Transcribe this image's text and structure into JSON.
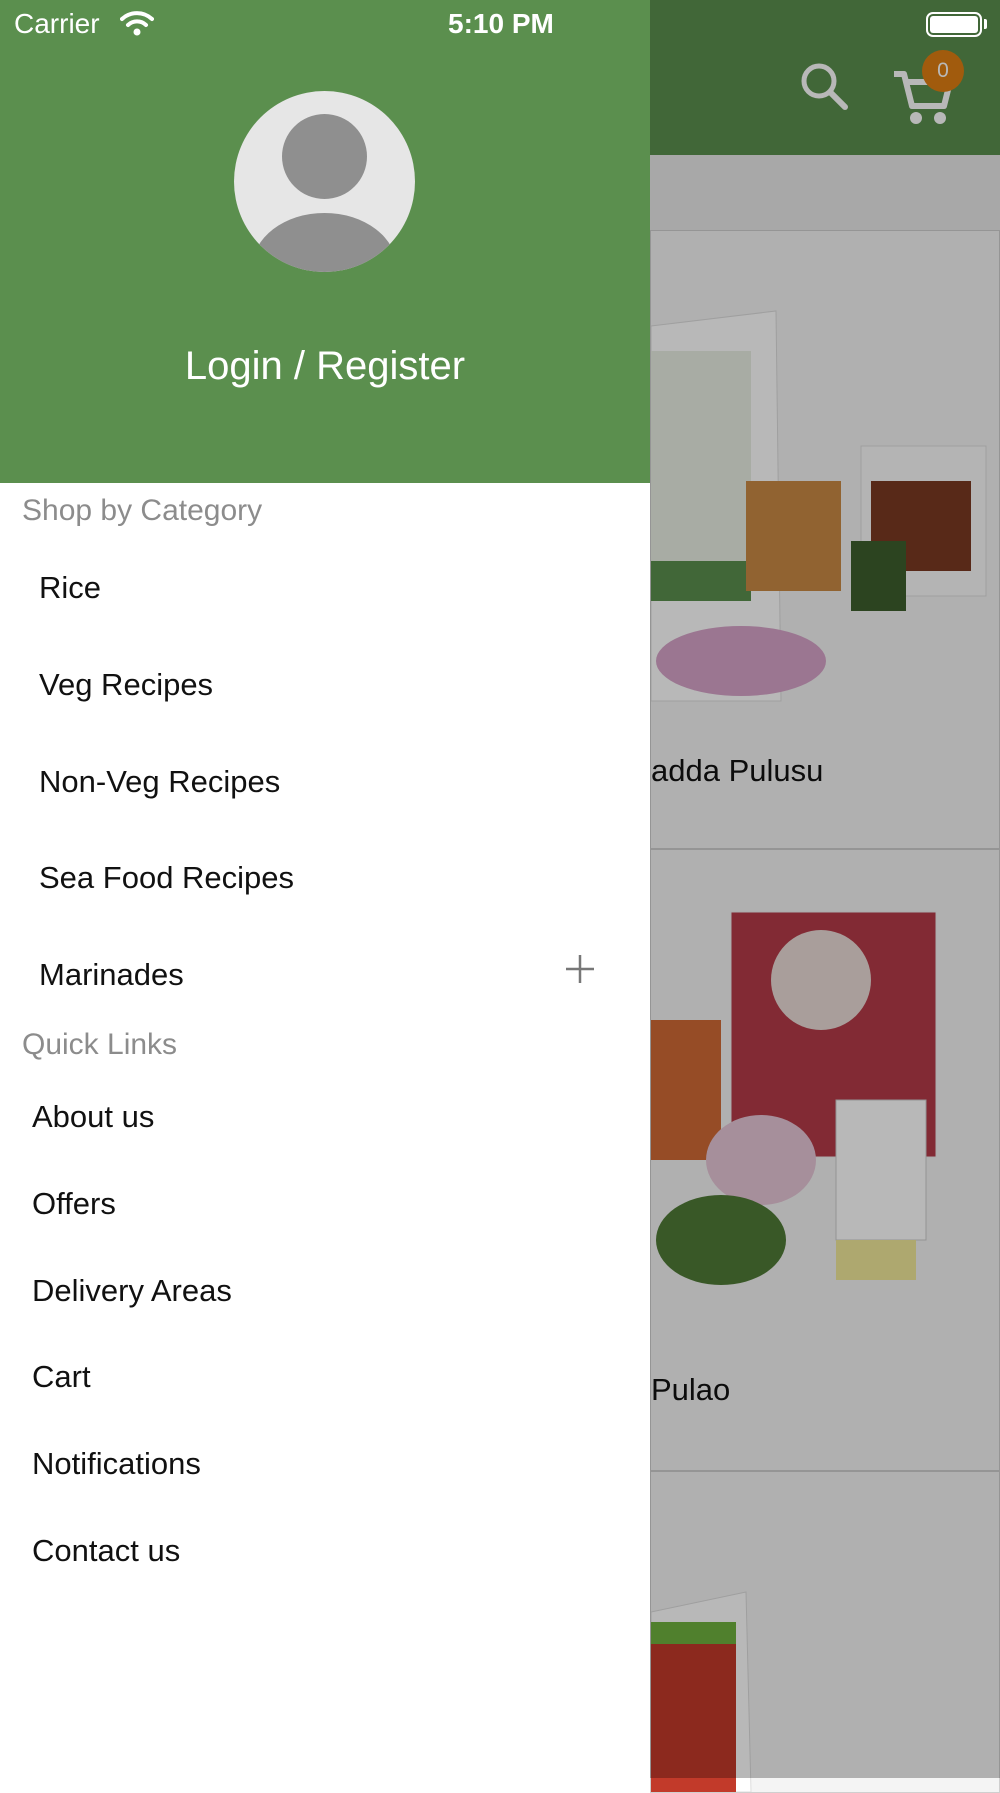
{
  "status_bar": {
    "carrier": "Carrier",
    "time": "5:10 PM"
  },
  "app_header": {
    "cart_count": "0"
  },
  "products": [
    {
      "title": "adda Pulusu"
    },
    {
      "title": "Pulao"
    },
    {
      "title": ""
    }
  ],
  "drawer": {
    "login_label": "Login / Register",
    "shop_by_category_title": "Shop by Category",
    "categories": [
      {
        "label": "Rice"
      },
      {
        "label": "Veg Recipes"
      },
      {
        "label": "Non-Veg Recipes"
      },
      {
        "label": "Sea Food Recipes"
      },
      {
        "label": "Marinades"
      }
    ],
    "quick_links_title": "Quick Links",
    "quick_links": [
      {
        "label": "About us"
      },
      {
        "label": "Offers"
      },
      {
        "label": "Delivery Areas"
      },
      {
        "label": "Cart"
      },
      {
        "label": "Notifications"
      },
      {
        "label": "Contact us"
      }
    ]
  },
  "colors": {
    "brand_green": "#5b8f4e",
    "badge_orange": "#e07f12",
    "section_gray": "#8c8c8c"
  }
}
